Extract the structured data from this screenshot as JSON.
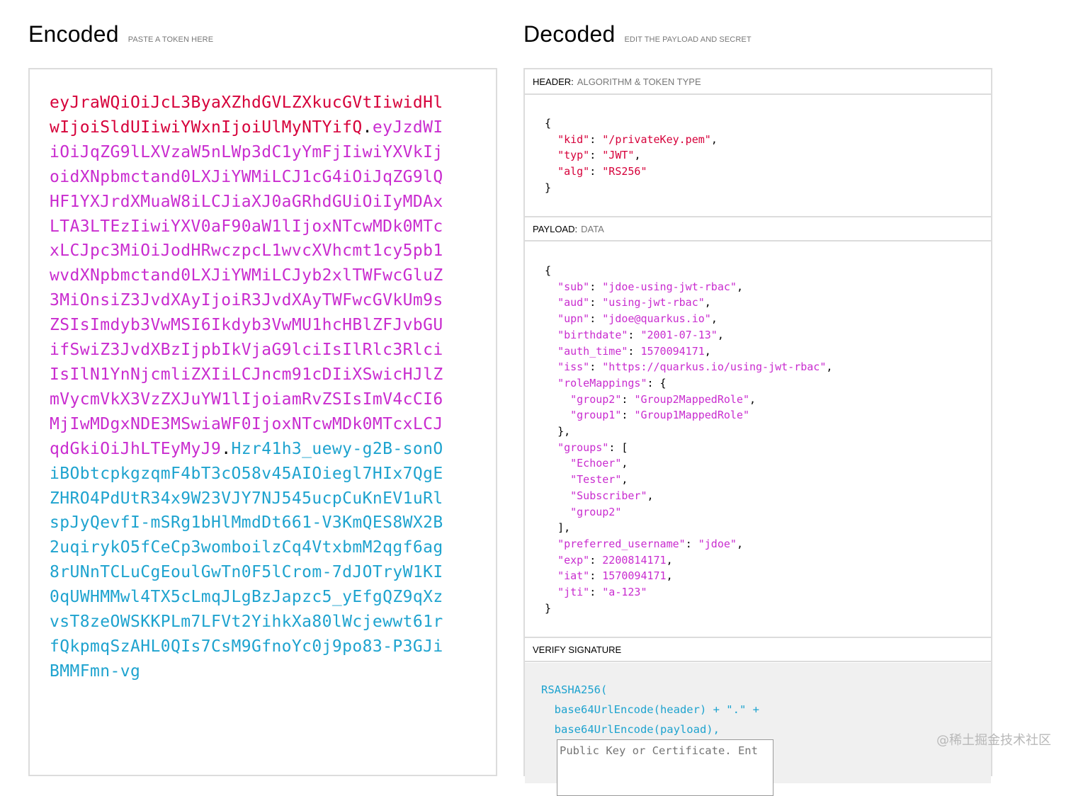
{
  "encoded": {
    "title": "Encoded",
    "subtitle": "PASTE A TOKEN HERE",
    "token_header": "eyJraWQiOiJcL3ByaXZhdGVLZXkucGVtIiwidHlwIjoiSldUIiwiYWxnIjoiUlMyNTYifQ",
    "token_payload": "eyJzdWIiOiJqZG9lLXVzaW5nLWp3dC1yYmFjIiwiYXVkIjoidXNpbmctand0LXJiYWMiLCJ1cG4iOiJqZG9lQHF1YXJrdXMuaW8iLCJiaXJ0aGRhdGUiOiIyMDAxLTA3LTEzIiwiYXV0aF90aW1lIjoxNTcwMDk0MTcxLCJpc3MiOiJodHRwczpcL1wvcXVhcmt1cy5pb1wvdXNpbmctand0LXJiYWMiLCJyb2xlTWFwcGluZ3MiOnsiZ3JvdXAyIjoiR3JvdXAyTWFwcGVkUm9sZSIsImdyb3VwMSI6Ikdyb3VwMU1hcHBlZFJvbGUifSwiZ3JvdXBzIjpbIkVjaG9lciIsIlRlc3RlciIsIlN1YnNjcmliZXIiLCJncm91cDIiXSwicHJlZmVycmVkX3VzZXJuYW1lIjoiamRvZSIsImV4cCI6MjIwMDgxNDE3MSwiaWF0IjoxNTcwMDk0MTcxLCJqdGkiOiJhLTEyMyJ9",
    "token_signature": "Hzr41h3_uewy-g2B-sonOiBObtcpkgzqmF4bT3cO58v45AIOiegl7HIx7QgEZHRO4PdUtR34x9W23VJY7NJ545ucpCuKnEV1uRlspJyQevfI-mSRg1bHlMmdDt661-V3KmQES8WX2B2uqirykO5fCeCp3womboilzCq4VtxbmM2qgf6ag8rUNnTCLuCgEoulGwTn0F5lCrom-7dJOTryW1KI0qUWHMMwl4TX5cLmqJLgBzJapzc5_yEfgQZ9qXzvsT8zeOWSKKPLm7LFVt2YihkXa80lWcjewwt61rfQkpmqSzAHL0QIs7CsM9GfnoYc0j9po83-P3GJiBMMFmn-vg",
    "dot": "."
  },
  "decoded": {
    "title": "Decoded",
    "subtitle": "EDIT THE PAYLOAD AND SECRET",
    "header_label": "HEADER:",
    "header_desc": "ALGORITHM & TOKEN TYPE",
    "payload_label": "PAYLOAD:",
    "payload_desc": "DATA",
    "signature_label": "VERIFY SIGNATURE",
    "header_fields": [
      {
        "key": "kid",
        "value": "\"/privateKey.pem\""
      },
      {
        "key": "typ",
        "value": "\"JWT\""
      },
      {
        "key": "alg",
        "value": "\"RS256\""
      }
    ],
    "payload_fields": [
      {
        "key": "sub",
        "value": "\"jdoe-using-jwt-rbac\""
      },
      {
        "key": "aud",
        "value": "\"using-jwt-rbac\""
      },
      {
        "key": "upn",
        "value": "\"jdoe@quarkus.io\""
      },
      {
        "key": "birthdate",
        "value": "\"2001-07-13\""
      },
      {
        "key": "auth_time",
        "value": "1570094171"
      },
      {
        "key": "iss",
        "value": "\"https://quarkus.io/using-jwt-rbac\""
      }
    ],
    "role_mappings_key": "roleMappings",
    "role_mappings": [
      {
        "key": "group2",
        "value": "\"Group2MappedRole\""
      },
      {
        "key": "group1",
        "value": "\"Group1MappedRole\""
      }
    ],
    "groups_key": "groups",
    "groups": [
      "\"Echoer\"",
      "\"Tester\"",
      "\"Subscriber\"",
      "\"group2\""
    ],
    "payload_tail": [
      {
        "key": "preferred_username",
        "value": "\"jdoe\""
      },
      {
        "key": "exp",
        "value": "2200814171"
      },
      {
        "key": "iat",
        "value": "1570094171"
      },
      {
        "key": "jti",
        "value": "\"a-123\""
      }
    ],
    "signature_code": [
      "RSASHA256(",
      "  base64UrlEncode(header) + \".\" +",
      "  base64UrlEncode(payload),"
    ],
    "public_key_placeholder": "Public Key or Certificate. Ent"
  },
  "watermark": "@稀土掘金技术社区",
  "colors": {
    "header": "#d6003a",
    "payload": "#c92ccf",
    "signature": "#1ea3cf"
  }
}
